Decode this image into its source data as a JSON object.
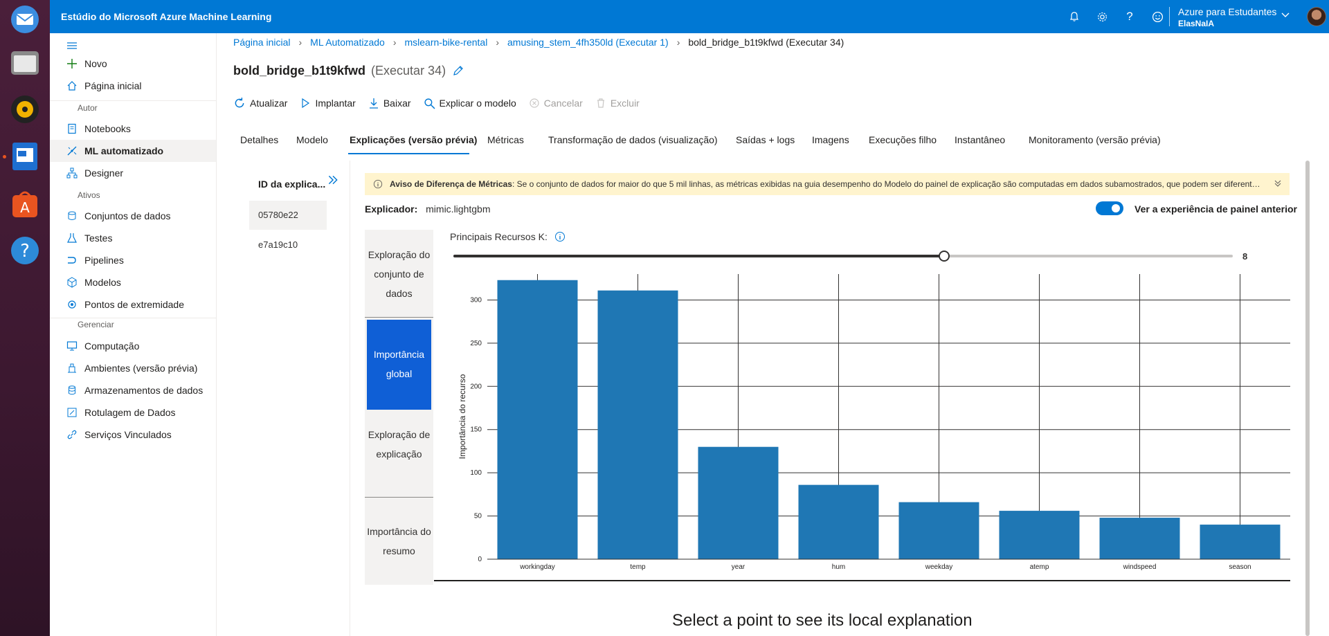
{
  "app": {
    "title": "Estúdio do Microsoft Azure Machine Learning",
    "account_name": "Azure para Estudantes",
    "account_user": "ElasNaIA"
  },
  "nav": {
    "new_label": "Novo",
    "home_label": "Página inicial",
    "section_author": "Autor",
    "author_items": [
      "Notebooks",
      "ML automatizado",
      "Designer"
    ],
    "section_assets": "Ativos",
    "asset_items": [
      "Conjuntos de dados",
      "Testes",
      "Pipelines",
      "Modelos",
      "Pontos de extremidade"
    ],
    "section_manage": "Gerenciar",
    "manage_items": [
      "Computação",
      "Ambientes (versão prévia)",
      "Armazenamentos de dados",
      "Rotulagem de Dados",
      "Serviços Vinculados"
    ]
  },
  "breadcrumb": [
    "Página inicial",
    "ML Automatizado",
    "mslearn-bike-rental",
    "amusing_stem_4fh350ld (Executar 1)",
    "bold_bridge_b1t9kfwd (Executar 34)"
  ],
  "page": {
    "title": "bold_bridge_b1t9kfwd",
    "run": "(Executar 34)"
  },
  "toolbar": {
    "refresh": "Atualizar",
    "deploy": "Implantar",
    "download": "Baixar",
    "explain": "Explicar o modelo",
    "cancel": "Cancelar",
    "delete": "Excluir"
  },
  "tabs": [
    "Detalhes",
    "Modelo",
    "Explicações (versão prévia)",
    "Métricas",
    "Transformação de dados (visualização)",
    "Saídas + logs",
    "Imagens",
    "Execuções filho",
    "Instantâneo",
    "Monitoramento (versão prévia)"
  ],
  "runs": {
    "header": "ID da explica...",
    "items": [
      "05780e22",
      "e7a19c10"
    ]
  },
  "warning": {
    "title": "Aviso de Diferença de Métricas",
    "text": ": Se o conjunto de dados for maior do que 5 mil linhas, as métricas exibidas na guia desempenho do Modelo do painel de explicação são computadas em dados subamostrados, que podem ser diferentes ..."
  },
  "explainer": {
    "label": "Explicador:",
    "value": "mimic.lightgbm",
    "toggle_label": "Ver a experiência de painel anterior",
    "toggle_on": true
  },
  "side_tabs": [
    "Exploração do conjunto de dados",
    "Importância global",
    "Exploração de explicação",
    "Importância do resumo"
  ],
  "topk": {
    "label": "Principais Recursos K:",
    "value": "8",
    "fraction": 0.63
  },
  "chart_data": {
    "type": "bar",
    "categories": [
      "workingday",
      "temp",
      "year",
      "hum",
      "weekday",
      "atemp",
      "windspeed",
      "season"
    ],
    "values": [
      323,
      311,
      130,
      86,
      66,
      56,
      48,
      40
    ],
    "xlabel": "",
    "ylabel": "Importância do recurso",
    "ylim": [
      0,
      330
    ],
    "yticks": [
      0,
      50,
      100,
      150,
      200,
      250,
      300
    ],
    "grid": true,
    "color": "#1f77b4"
  },
  "local_message": "Select a point to see its local explanation",
  "colors": {
    "brand": "#0078d4",
    "active_side_tab": "#0f5fd6",
    "warning_bg": "#fff4ce"
  }
}
